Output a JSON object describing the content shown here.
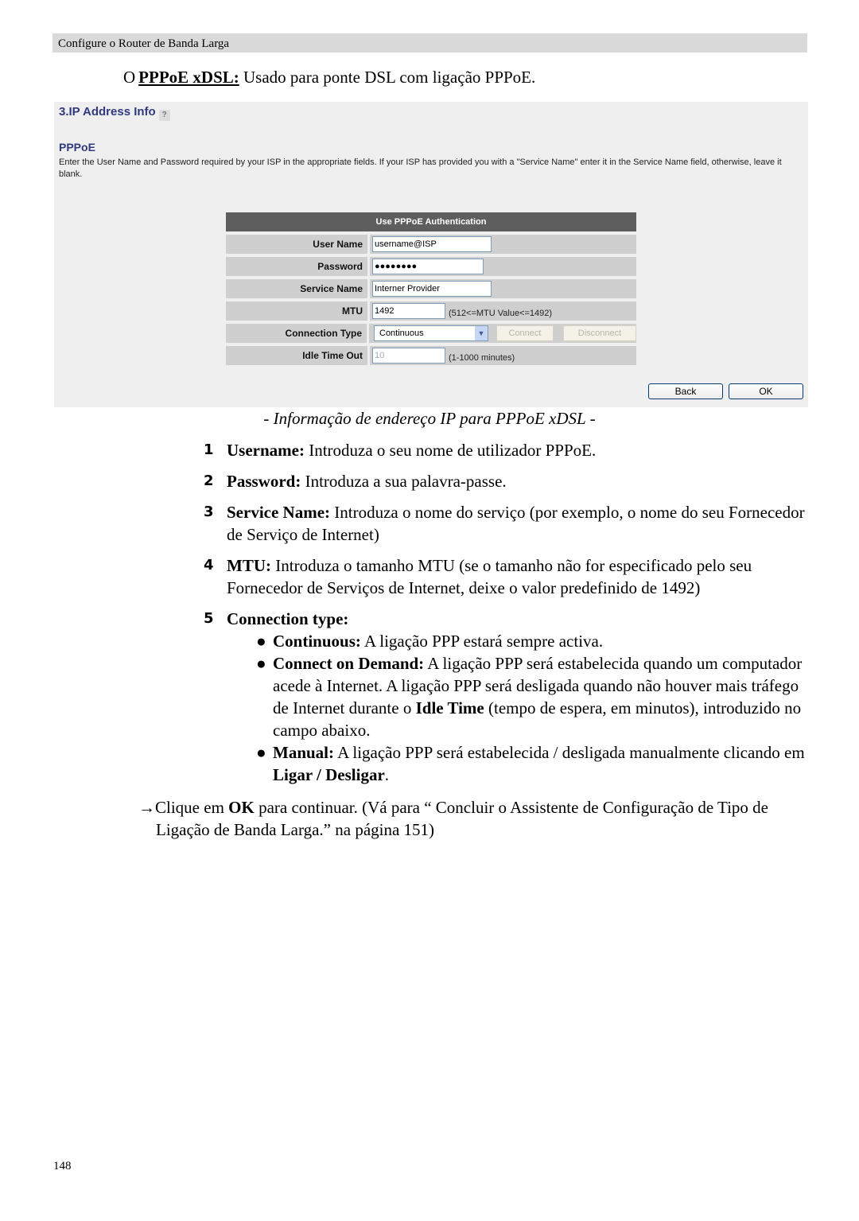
{
  "running_header": "Configure o Router de Banda Larga",
  "intro": {
    "bullet": "O",
    "title": "PPPoE xDSL:",
    "text": " Usado para ponte DSL com ligação PPPoE."
  },
  "panel": {
    "title": "3.IP Address Info",
    "help_icon": "help-icon",
    "section_title": "PPPoE",
    "description": "Enter the User Name and Password required by your ISP in the appropriate fields. If your ISP has provided you with a \"Service Name\" enter it in the Service Name field, otherwise, leave it blank.",
    "form": {
      "header": "Use PPPoE Authentication",
      "user_name": {
        "label": "User Name",
        "value": "username@ISP"
      },
      "password": {
        "label": "Password",
        "value": "●●●●●●●●"
      },
      "service_name": {
        "label": "Service Name",
        "value": "Interner Provider"
      },
      "mtu": {
        "label": "MTU",
        "value": "1492",
        "hint": "(512<=MTU Value<=1492)"
      },
      "connection_type": {
        "label": "Connection Type",
        "selected": "Continuous",
        "connect_label": "Connect",
        "disconnect_label": "Disconnect"
      },
      "idle_time_out": {
        "label": "Idle Time Out",
        "value": "10",
        "hint": "(1-1000 minutes)"
      }
    },
    "back_label": "Back",
    "ok_label": "OK"
  },
  "caption": "- Informação de endereço IP para PPPoE xDSL -",
  "items": [
    {
      "num": "1",
      "term": "Username:",
      "text": " Introduza o seu nome de utilizador PPPoE."
    },
    {
      "num": "2",
      "term": "Password:",
      "text": " Introduza a sua palavra-passe."
    },
    {
      "num": "3",
      "term": "Service Name:",
      "text": " Introduza o nome do serviço (por exemplo, o nome do seu Fornecedor de Serviço de Internet)"
    },
    {
      "num": "4",
      "term": "MTU:",
      "text": " Introduza o tamanho MTU (se o tamanho não for especificado pelo seu Fornecedor de Serviços de Internet, deixe o valor predefinido de 1492)"
    },
    {
      "num": "5",
      "term": "Connection type:",
      "text": ""
    }
  ],
  "connection_types": [
    {
      "bullet": "●",
      "term": "Continuous:",
      "text": " A ligação PPP estará sempre activa."
    },
    {
      "bullet": "●",
      "term": "Connect on Demand:",
      "text_a": " A ligação PPP será estabelecida quando um computador acede à Internet. A ligação PPP será desligada quando não houver mais tráfego de Internet durante o ",
      "bold_b": "Idle Time",
      "text_c": " (tempo de espera, em minutos), introduzido no campo abaixo."
    },
    {
      "bullet": "●",
      "term": "Manual:",
      "text_a": " A ligação PPP será estabelecida / desligada manualmente clicando em ",
      "bold_b": "Ligar / Desligar",
      "text_c": "."
    }
  ],
  "note": {
    "arrow": "→",
    "text_a": "Clique em ",
    "bold": "OK",
    "text_b": " para continuar. (Vá para “ Concluir o Assistente de Configuração de Tipo de Ligação de Banda Larga.” na página 151)"
  },
  "page_number": "148"
}
